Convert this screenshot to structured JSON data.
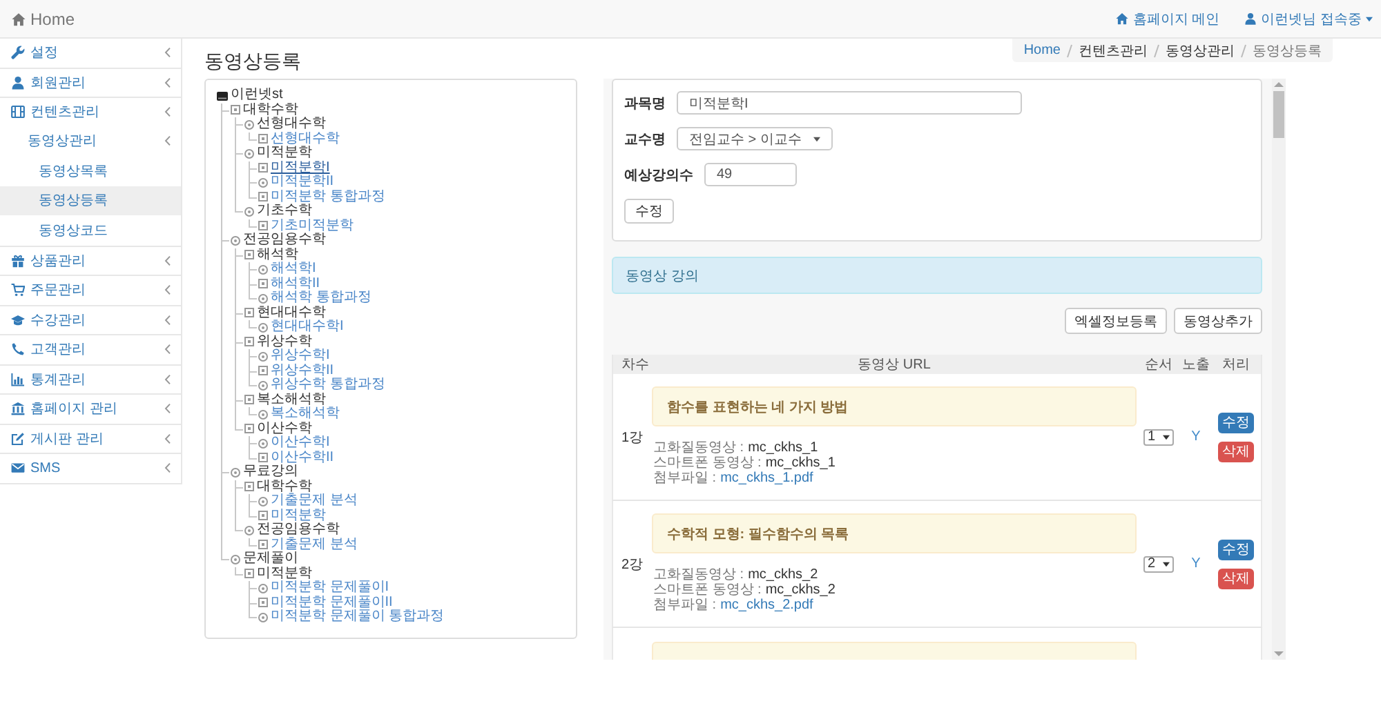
{
  "top_bar": {
    "brand": "Home",
    "links": [
      {
        "label": "홈페이지 메인",
        "dropdown": false
      },
      {
        "label": "이런넷님 접속중",
        "dropdown": true
      }
    ]
  },
  "sidebar": {
    "items": [
      {
        "label": "설정",
        "submenu": true,
        "selected": false
      },
      {
        "label": "회원관리",
        "submenu": true,
        "selected": false
      },
      {
        "label": "컨텐츠관리",
        "submenu": true,
        "selected": false,
        "children": [
          {
            "label": "동영상관리",
            "submenu": true,
            "selected": false,
            "children": [
              {
                "label": "동영상목록",
                "submenu": false,
                "selected": false
              },
              {
                "label": "동영상등록",
                "submenu": false,
                "selected": true
              },
              {
                "label": "동영상코드",
                "submenu": false,
                "selected": false
              }
            ]
          }
        ]
      },
      {
        "label": "상품관리",
        "submenu": true,
        "selected": false
      },
      {
        "label": "주문관리",
        "submenu": true,
        "selected": false
      },
      {
        "label": "수강관리",
        "submenu": true,
        "selected": false
      },
      {
        "label": "고객관리",
        "submenu": true,
        "selected": false
      },
      {
        "label": "통계관리",
        "submenu": true,
        "selected": false
      },
      {
        "label": "홈페이지 관리",
        "submenu": true,
        "selected": false
      },
      {
        "label": "게시판 관리",
        "submenu": true,
        "selected": false
      },
      {
        "label": "SMS",
        "submenu": true,
        "selected": false
      }
    ]
  },
  "page_title": "동영상등록",
  "breadcrumb": [
    {
      "label": "Home",
      "kind": "link"
    },
    {
      "label": "컨텐츠관리",
      "kind": "text"
    },
    {
      "label": "동영상관리",
      "kind": "text"
    },
    {
      "label": "동영상등록",
      "kind": "current"
    }
  ],
  "course_tree": {
    "root": {
      "label": "이런넷st",
      "selected": false,
      "children": [
        {
          "label": "대학수학",
          "selected": false,
          "children": [
            {
              "label": "선형대수학",
              "selected": false,
              "children": [
                {
                  "label": "선형대수학",
                  "selected": false
                }
              ]
            },
            {
              "label": "미적분학",
              "selected": false,
              "children": [
                {
                  "label": "미적분학I",
                  "selected": true
                },
                {
                  "label": "미적분학II",
                  "selected": false
                },
                {
                  "label": "미적분학 통합과정",
                  "selected": false
                }
              ]
            },
            {
              "label": "기초수학",
              "selected": false,
              "children": [
                {
                  "label": "기초미적분학",
                  "selected": false
                }
              ]
            }
          ]
        },
        {
          "label": "전공임용수학",
          "selected": false,
          "children": [
            {
              "label": "해석학",
              "selected": false,
              "children": [
                {
                  "label": "해석학I",
                  "selected": false
                },
                {
                  "label": "해석학II",
                  "selected": false
                },
                {
                  "label": "해석학 통합과정",
                  "selected": false
                }
              ]
            },
            {
              "label": "현대대수학",
              "selected": false,
              "children": [
                {
                  "label": "현대대수학I",
                  "selected": false
                }
              ]
            },
            {
              "label": "위상수학",
              "selected": false,
              "children": [
                {
                  "label": "위상수학I",
                  "selected": false
                },
                {
                  "label": "위상수학II",
                  "selected": false
                },
                {
                  "label": "위상수학 통합과정",
                  "selected": false
                }
              ]
            },
            {
              "label": "복소해석학",
              "selected": false,
              "children": [
                {
                  "label": "복소해석학",
                  "selected": false
                }
              ]
            },
            {
              "label": "이산수학",
              "selected": false,
              "children": [
                {
                  "label": "이산수학I",
                  "selected": false
                },
                {
                  "label": "이산수학II",
                  "selected": false
                }
              ]
            }
          ]
        },
        {
          "label": "무료강의",
          "selected": false,
          "children": [
            {
              "label": "대학수학",
              "selected": false,
              "children": [
                {
                  "label": "기출문제 분석",
                  "selected": false
                },
                {
                  "label": "미적분학",
                  "selected": false
                }
              ]
            },
            {
              "label": "전공임용수학",
              "selected": false,
              "children": [
                {
                  "label": "기출문제 분석",
                  "selected": false
                }
              ]
            }
          ]
        },
        {
          "label": "문제풀이",
          "selected": false,
          "children": [
            {
              "label": "미적분학",
              "selected": false,
              "children": [
                {
                  "label": "미적분학 문제풀이I",
                  "selected": false
                },
                {
                  "label": "미적분학 문제풀이II",
                  "selected": false
                },
                {
                  "label": "미적분학 문제풀이 통합과정",
                  "selected": false
                }
              ]
            }
          ]
        }
      ]
    }
  },
  "course_form": {
    "fields": [
      {
        "label": "과목명",
        "kind": "text",
        "value": "미적분학I"
      },
      {
        "label": "교수명",
        "kind": "select",
        "value": "전임교수 > 이교수"
      },
      {
        "label": "예상강의수",
        "kind": "number",
        "value": "49"
      }
    ],
    "submit": "수정"
  },
  "video_section": {
    "heading": "동영상 강의",
    "actions": [
      "엑셀정보등록",
      "동영상추가"
    ],
    "columns": [
      "차수",
      "동영상 URL",
      "순서",
      "노출",
      "처리"
    ],
    "lectures": [
      {
        "kind": "full",
        "number": "1강",
        "title": "함수를 표현하는 네 가지 방법",
        "hd_label": "고화질동영상 :",
        "hd_code": "mc_ckhs_1",
        "mobile_label": "스마트폰 동영상 :",
        "mobile_code": "mc_ckhs_1",
        "file_label": "첨부파일 :",
        "file_name": "mc_ckhs_1.pdf",
        "order": "1",
        "visible": "Y",
        "edit_label": "수정",
        "delete_label": "삭제"
      },
      {
        "kind": "full",
        "number": "2강",
        "title": "수학적 모형: 필수함수의 목록",
        "hd_label": "고화질동영상 :",
        "hd_code": "mc_ckhs_2",
        "mobile_label": "스마트폰 동영상 :",
        "mobile_code": "mc_ckhs_2",
        "file_label": "첨부파일 :",
        "file_name": "mc_ckhs_2.pdf",
        "order": "2",
        "visible": "Y",
        "edit_label": "수정",
        "delete_label": "삭제"
      },
      {
        "kind": "cut"
      }
    ]
  }
}
